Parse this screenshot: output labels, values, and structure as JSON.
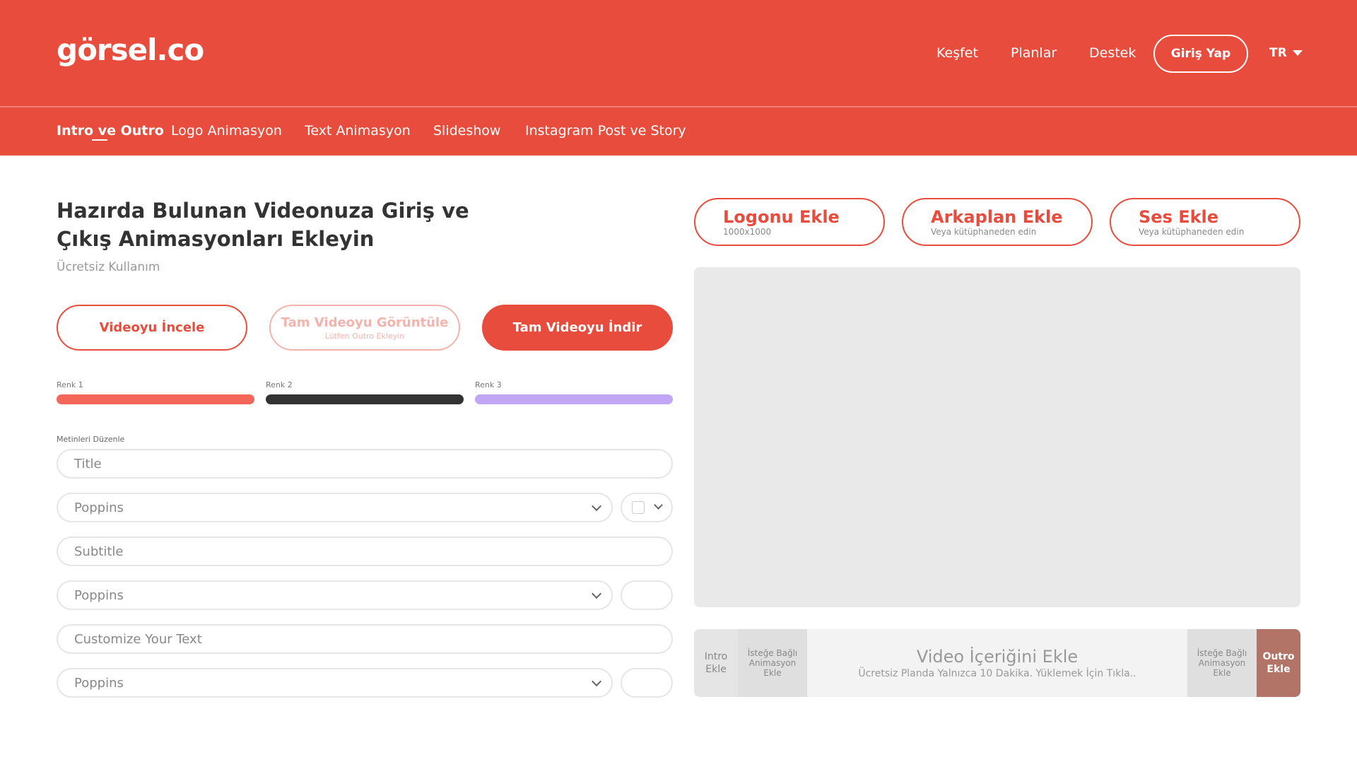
{
  "header": {
    "logo": "görsel.co",
    "nav": [
      "Keşfet",
      "Planlar",
      "Destek"
    ],
    "login_label": "Giriş Yap",
    "lang": "TR"
  },
  "subnav": {
    "items": [
      "Intro ve Outro",
      "Logo Animasyon",
      "Text Animasyon",
      "Slideshow",
      "Instagram Post ve Story"
    ],
    "active": "Intro ve Outro"
  },
  "main": {
    "title": "Hazırda Bulunan Videonuza Giriş ve Çıkış Animasyonları Ekleyin",
    "subtitle": "Ücretsiz Kullanım",
    "buttons": {
      "review": "Videoyu İncele",
      "view_full": "Tam Videoyu Görüntüle",
      "view_full_hint": "Lütfen Outro Ekleyin",
      "download": "Tam Videoyu İndir"
    },
    "colors": [
      {
        "label": "Renk 1",
        "value": "#f4655a"
      },
      {
        "label": "Renk 2",
        "value": "#333333"
      },
      {
        "label": "Renk 3",
        "value": "#c0a6f5"
      }
    ],
    "texts_label": "Metinleri Düzenle",
    "fields": {
      "title_placeholder": "Title",
      "subtitle_placeholder": "Subtitle",
      "custom_placeholder": "Customize Your Text",
      "font1": "Poppins",
      "font2": "Poppins",
      "font3": "Poppins"
    }
  },
  "right": {
    "logo_btn": {
      "label": "Logonu Ekle",
      "hint": "1000x1000"
    },
    "bg_btn": {
      "label": "Arkaplan Ekle",
      "hint": "Veya kütüphaneden edin"
    },
    "audio_btn": {
      "label": "Ses Ekle",
      "hint": "Veya kütüphaneden edin"
    },
    "timeline": {
      "intro_line1": "Intro",
      "intro_line2": "Ekle",
      "optional_line1": "İsteğe Bağlı",
      "optional_line2": "Animasyon",
      "optional_line3": "Ekle",
      "main_title": "Video İçeriğini Ekle",
      "main_sub": "Ücretsiz Planda Yalnızca 10 Dakika. Yüklemek İçin Tıkla..",
      "outro_line1": "Outro",
      "outro_line2": "Ekle"
    }
  }
}
